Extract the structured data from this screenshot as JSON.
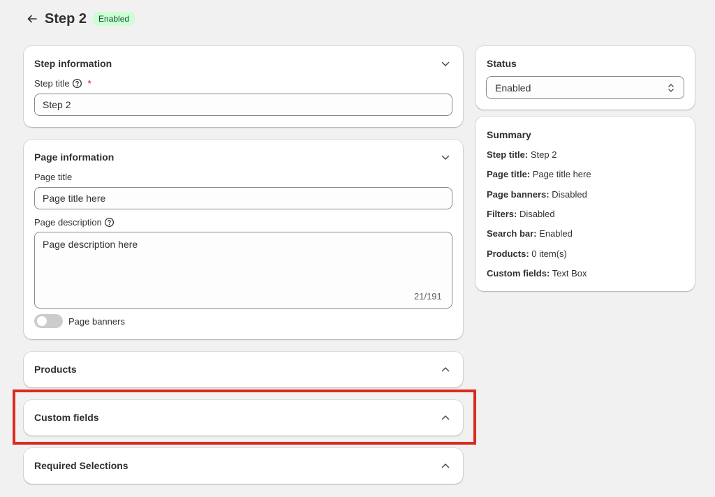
{
  "header": {
    "title": "Step 2",
    "status_badge": "Enabled"
  },
  "step_information": {
    "title": "Step information",
    "step_title_label": "Step title",
    "required_mark": "*",
    "step_title_value": "Step 2"
  },
  "page_information": {
    "title": "Page information",
    "page_title_label": "Page title",
    "page_title_value": "Page title here",
    "page_description_label": "Page description",
    "page_description_value": "Page description here",
    "char_counter": "21/191",
    "page_banners_label": "Page banners",
    "page_banners_enabled": false
  },
  "sections": {
    "products": "Products",
    "custom_fields": "Custom fields",
    "required_selections": "Required Selections"
  },
  "status": {
    "title": "Status",
    "value": "Enabled"
  },
  "summary": {
    "title": "Summary",
    "rows": [
      {
        "key": "Step title:",
        "value": "Step 2"
      },
      {
        "key": "Page title:",
        "value": "Page title here"
      },
      {
        "key": "Page banners:",
        "value": "Disabled"
      },
      {
        "key": "Filters:",
        "value": "Disabled"
      },
      {
        "key": "Search bar:",
        "value": "Enabled"
      },
      {
        "key": "Products:",
        "value": "0 item(s)"
      },
      {
        "key": "Custom fields:",
        "value": "Text Box"
      }
    ]
  },
  "colors": {
    "highlight": "#d82c20",
    "badge_bg": "#cdfed4",
    "badge_text": "#0c5132",
    "required": "#c70a24"
  }
}
